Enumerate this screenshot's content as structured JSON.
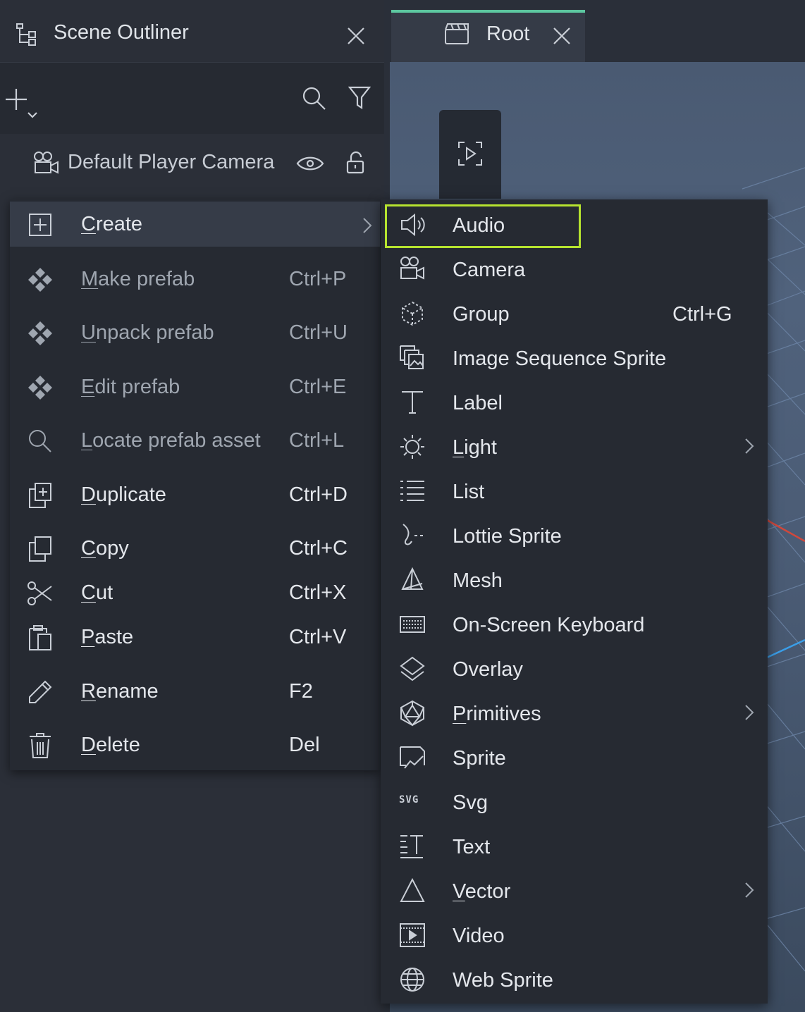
{
  "outliner": {
    "title": "Scene Outliner",
    "camera_item": "Default Player Camera"
  },
  "viewport": {
    "tab_label": "Root"
  },
  "context_menu": {
    "items": [
      {
        "label": "Create",
        "shortcut": "",
        "icon": "plus-square-icon",
        "enabled": true,
        "submenu": true
      },
      {
        "label": "Make prefab",
        "shortcut": "Ctrl+P",
        "icon": "prefab-icon",
        "enabled": false
      },
      {
        "label": "Unpack prefab",
        "shortcut": "Ctrl+U",
        "icon": "prefab-icon",
        "enabled": false
      },
      {
        "label": "Edit prefab",
        "shortcut": "Ctrl+E",
        "icon": "prefab-icon",
        "enabled": false
      },
      {
        "label": "Locate prefab asset",
        "shortcut": "Ctrl+L",
        "icon": "search-icon",
        "enabled": false
      },
      {
        "label": "Duplicate",
        "shortcut": "Ctrl+D",
        "icon": "duplicate-icon",
        "enabled": true
      },
      {
        "label": "Copy",
        "shortcut": "Ctrl+C",
        "icon": "copy-icon",
        "enabled": true
      },
      {
        "label": "Cut",
        "shortcut": "Ctrl+X",
        "icon": "scissors-icon",
        "enabled": true
      },
      {
        "label": "Paste",
        "shortcut": "Ctrl+V",
        "icon": "paste-icon",
        "enabled": true
      },
      {
        "label": "Rename",
        "shortcut": "F2",
        "icon": "pencil-icon",
        "enabled": true
      },
      {
        "label": "Delete",
        "shortcut": "Del",
        "icon": "trash-icon",
        "enabled": true
      }
    ]
  },
  "create_submenu": {
    "items": [
      {
        "label": "Audio",
        "shortcut": "",
        "icon": "speaker-icon",
        "highlighted": true
      },
      {
        "label": "Camera",
        "shortcut": "",
        "icon": "camera-icon"
      },
      {
        "label": "Group",
        "shortcut": "Ctrl+G",
        "icon": "group-icon"
      },
      {
        "label": "Image Sequence Sprite",
        "shortcut": "",
        "icon": "image-sequence-icon"
      },
      {
        "label": "Label",
        "shortcut": "",
        "icon": "text-t-icon"
      },
      {
        "label": "Light",
        "shortcut": "",
        "icon": "sun-icon",
        "submenu": true
      },
      {
        "label": "List",
        "shortcut": "",
        "icon": "list-icon"
      },
      {
        "label": "Lottie Sprite",
        "shortcut": "",
        "icon": "lottie-icon"
      },
      {
        "label": "Mesh",
        "shortcut": "",
        "icon": "mesh-icon"
      },
      {
        "label": "On-Screen Keyboard",
        "shortcut": "",
        "icon": "keyboard-icon"
      },
      {
        "label": "Overlay",
        "shortcut": "",
        "icon": "layers-icon"
      },
      {
        "label": "Primitives",
        "shortcut": "",
        "icon": "polyhedron-icon",
        "submenu": true
      },
      {
        "label": "Sprite",
        "shortcut": "",
        "icon": "sprite-icon"
      },
      {
        "label": "Svg",
        "shortcut": "",
        "icon": "svg-icon",
        "icon_text": "SVG"
      },
      {
        "label": "Text",
        "shortcut": "",
        "icon": "text-lines-icon"
      },
      {
        "label": "Vector",
        "shortcut": "",
        "icon": "triangle-icon",
        "submenu": true
      },
      {
        "label": "Video",
        "shortcut": "",
        "icon": "video-icon"
      },
      {
        "label": "Web Sprite",
        "shortcut": "",
        "icon": "globe-icon"
      }
    ]
  },
  "colors": {
    "highlight_border": "#b6e32f",
    "tab_accent": "#5cc7a0",
    "menu_bg": "#262a32"
  }
}
